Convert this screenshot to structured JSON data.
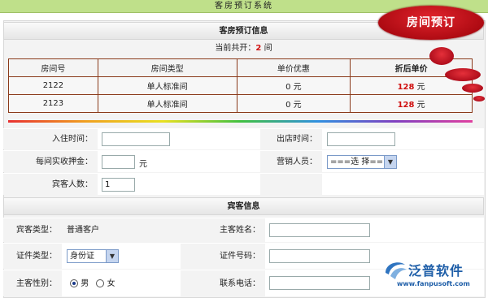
{
  "window": {
    "title": "客房预订系统"
  },
  "badge": {
    "label": "房间预订"
  },
  "booking_section": {
    "title": "客房预订信息",
    "count_prefix": "当前共开：",
    "count_value": "2",
    "count_suffix": " 间"
  },
  "rooms_table": {
    "headers": [
      "房间号",
      "房间类型",
      "单价优惠",
      "折后单价"
    ],
    "rows": [
      {
        "room_no": "2122",
        "room_type": "单人标准间",
        "discount": "0 元",
        "final_price": "128",
        "unit": " 元"
      },
      {
        "room_no": "2123",
        "room_type": "单人标准间",
        "discount": "0 元",
        "final_price": "128",
        "unit": " 元"
      }
    ]
  },
  "stay_form": {
    "checkin_label": "入住时间：",
    "checkin_value": "",
    "checkout_label": "出店时间：",
    "checkout_value": "",
    "deposit_label": "每间实收押金：",
    "deposit_value": "",
    "deposit_unit": "元",
    "sales_label": "营销人员：",
    "sales_value": "===选  择===",
    "guests_label": "宾客人数：",
    "guests_value": "1"
  },
  "guest_section": {
    "title": "宾客信息",
    "type_label": "宾客类型：",
    "type_value": "普通客户",
    "name_label": "主客姓名：",
    "name_value": "",
    "id_type_label": "证件类型：",
    "id_type_value": "身份证",
    "id_no_label": "证件号码：",
    "id_no_value": "",
    "gender_label": "主客性别：",
    "gender_male": "男",
    "gender_female": "女",
    "gender_selected": "男",
    "phone_label": "联系电话：",
    "phone_value": ""
  },
  "brand": {
    "name": "泛普软件",
    "url": "www.fanpusoft.com"
  },
  "colors": {
    "accent_red": "#d01010",
    "topbar_green": "#bfe08a",
    "badge_red": "#c0141c",
    "brand_blue": "#1e5ea8"
  }
}
